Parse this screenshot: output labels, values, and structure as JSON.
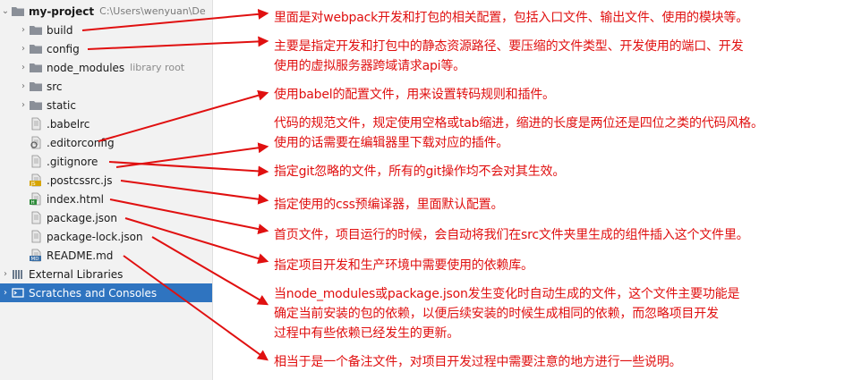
{
  "project": {
    "name": "my-project",
    "path": "C:\\Users\\wenyuan\\De"
  },
  "tree": [
    {
      "label": "build",
      "type": "folder",
      "icon": "folder-icon"
    },
    {
      "label": "config",
      "type": "folder",
      "icon": "folder-icon"
    },
    {
      "label": "node_modules",
      "type": "folder",
      "icon": "folder-icon",
      "hint": "library root"
    },
    {
      "label": "src",
      "type": "folder",
      "icon": "folder-icon"
    },
    {
      "label": "static",
      "type": "folder",
      "icon": "folder-icon"
    },
    {
      "label": ".babelrc",
      "type": "file",
      "icon": "config-file-icon"
    },
    {
      "label": ".editorconfig",
      "type": "file",
      "icon": "gear-file-icon"
    },
    {
      "label": ".gitignore",
      "type": "file",
      "icon": "text-file-icon"
    },
    {
      "label": ".postcssrc.js",
      "type": "file",
      "icon": "js-file-icon",
      "badge": "JS"
    },
    {
      "label": "index.html",
      "type": "file",
      "icon": "html-file-icon",
      "badge": "H"
    },
    {
      "label": "package.json",
      "type": "file",
      "icon": "json-file-icon"
    },
    {
      "label": "package-lock.json",
      "type": "file",
      "icon": "json-file-icon"
    },
    {
      "label": "README.md",
      "type": "file",
      "icon": "md-file-icon",
      "badge": "MD"
    }
  ],
  "external_libraries": "External Libraries",
  "scratches": "Scratches and Consoles",
  "notes": [
    [
      "里面是对webpack开发和打包的相关配置，包括入口文件、输出文件、使用的模块等。"
    ],
    [
      "主要是指定开发和打包中的静态资源路径、要压缩的文件类型、开发使用的端口、开发",
      "使用的虚拟服务器跨域请求api等。"
    ],
    [
      "使用babel的配置文件，用来设置转码规则和插件。"
    ],
    [
      "代码的规范文件，规定使用空格或tab缩进，缩进的长度是两位还是四位之类的代码风格。",
      "使用的话需要在编辑器里下载对应的插件。"
    ],
    [
      "指定git忽略的文件，所有的git操作均不会对其生效。"
    ],
    [
      "指定使用的css预编译器，里面默认配置。"
    ],
    [
      "首页文件，项目运行的时候，会自动将我们在src文件夹里生成的组件插入这个文件里。"
    ],
    [
      "指定项目开发和生产环境中需要使用的依赖库。"
    ],
    [
      "当node_modules或package.json发生变化时自动生成的文件，这个文件主要功能是",
      "确定当前安装的包的依赖，以便后续安装的时候生成相同的依赖，而忽略项目开发",
      "过程中有些依赖已经发生的更新。"
    ],
    [
      "相当于是一个备注文件，对项目开发过程中需要注意的地方进行一些说明。"
    ]
  ],
  "colors": {
    "annotation": "#e01010",
    "selection": "#2f74c0",
    "folder": "#8a8f98"
  }
}
